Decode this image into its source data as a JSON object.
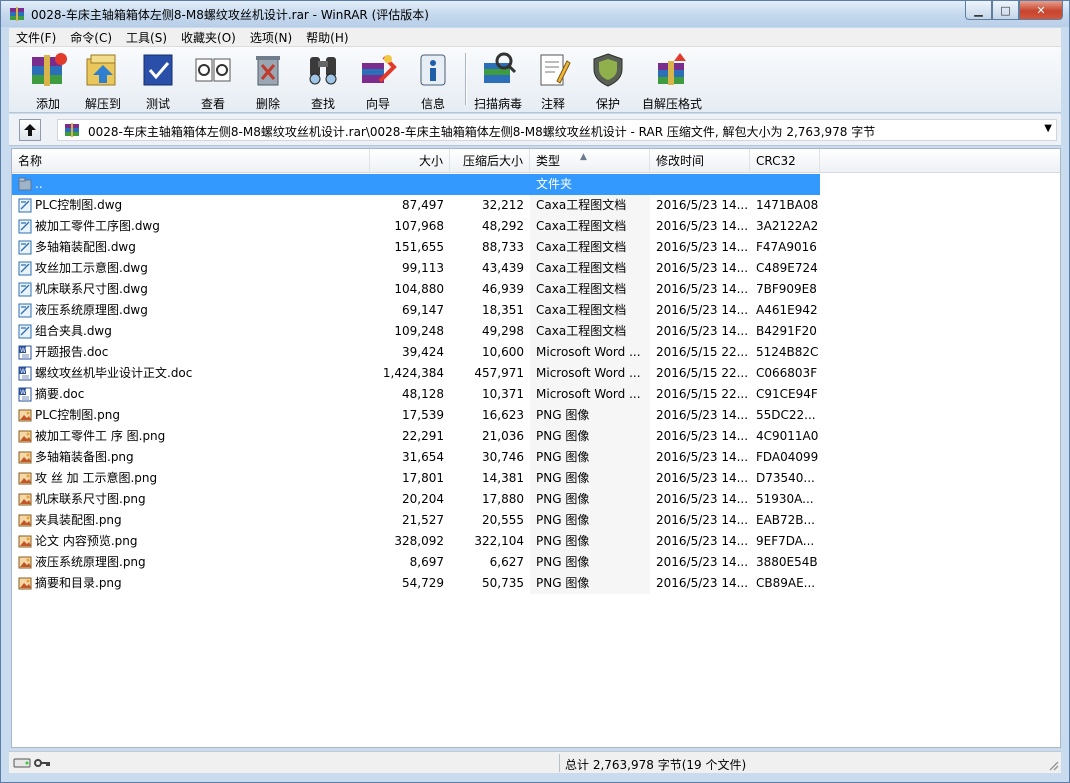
{
  "window": {
    "title": "0028-车床主轴箱箱体左侧8-M8螺纹攻丝机设计.rar - WinRAR (评估版本)",
    "controls": {
      "minimize": "▁",
      "maximize": "□",
      "close": "✕"
    }
  },
  "menu": [
    {
      "label": "文件(F)"
    },
    {
      "label": "命令(C)"
    },
    {
      "label": "工具(S)"
    },
    {
      "label": "收藏夹(O)"
    },
    {
      "label": "选项(N)"
    },
    {
      "label": "帮助(H)"
    }
  ],
  "toolbar": [
    {
      "label": "添加",
      "icon": "add-archive-icon"
    },
    {
      "label": "解压到",
      "icon": "extract-to-icon"
    },
    {
      "label": "测试",
      "icon": "test-icon"
    },
    {
      "label": "查看",
      "icon": "view-icon"
    },
    {
      "label": "删除",
      "icon": "delete-icon"
    },
    {
      "label": "查找",
      "icon": "find-icon"
    },
    {
      "label": "向导",
      "icon": "wizard-icon"
    },
    {
      "label": "信息",
      "icon": "info-icon"
    },
    {
      "label": "扫描病毒",
      "icon": "virus-scan-icon"
    },
    {
      "label": "注释",
      "icon": "comment-icon"
    },
    {
      "label": "保护",
      "icon": "protect-icon"
    },
    {
      "label": "自解压格式",
      "icon": "sfx-icon"
    }
  ],
  "address": {
    "path": "0028-车床主轴箱箱体左侧8-M8螺纹攻丝机设计.rar\\0028-车床主轴箱箱体左侧8-M8螺纹攻丝机设计 - RAR 压缩文件, 解包大小为 2,763,978 字节"
  },
  "columns": {
    "name": "名称",
    "size": "大小",
    "packed": "压缩后大小",
    "type": "类型",
    "mtime": "修改时间",
    "crc": "CRC32"
  },
  "files": [
    {
      "name": "..",
      "size": "",
      "packed": "",
      "type": "文件夹",
      "mtime": "",
      "crc": "",
      "kind": "folder",
      "selected": true
    },
    {
      "name": "PLC控制图.dwg",
      "size": "87,497",
      "packed": "32,212",
      "type": "Caxa工程图文档",
      "mtime": "2016/5/23 14...",
      "crc": "1471BA08",
      "kind": "dwg"
    },
    {
      "name": "被加工零件工序图.dwg",
      "size": "107,968",
      "packed": "48,292",
      "type": "Caxa工程图文档",
      "mtime": "2016/5/23 14...",
      "crc": "3A2122A2",
      "kind": "dwg"
    },
    {
      "name": "多轴箱装配图.dwg",
      "size": "151,655",
      "packed": "88,733",
      "type": "Caxa工程图文档",
      "mtime": "2016/5/23 14...",
      "crc": "F47A9016",
      "kind": "dwg"
    },
    {
      "name": "攻丝加工示意图.dwg",
      "size": "99,113",
      "packed": "43,439",
      "type": "Caxa工程图文档",
      "mtime": "2016/5/23 14...",
      "crc": "C489E724",
      "kind": "dwg"
    },
    {
      "name": "机床联系尺寸图.dwg",
      "size": "104,880",
      "packed": "46,939",
      "type": "Caxa工程图文档",
      "mtime": "2016/5/23 14...",
      "crc": "7BF909E8",
      "kind": "dwg"
    },
    {
      "name": "液压系统原理图.dwg",
      "size": "69,147",
      "packed": "18,351",
      "type": "Caxa工程图文档",
      "mtime": "2016/5/23 14...",
      "crc": "A461E942",
      "kind": "dwg"
    },
    {
      "name": "组合夹具.dwg",
      "size": "109,248",
      "packed": "49,298",
      "type": "Caxa工程图文档",
      "mtime": "2016/5/23 14...",
      "crc": "B4291F20",
      "kind": "dwg"
    },
    {
      "name": "开题报告.doc",
      "size": "39,424",
      "packed": "10,600",
      "type": "Microsoft Word ...",
      "mtime": "2016/5/15 22...",
      "crc": "5124B82C",
      "kind": "doc"
    },
    {
      "name": "螺纹攻丝机毕业设计正文.doc",
      "size": "1,424,384",
      "packed": "457,971",
      "type": "Microsoft Word ...",
      "mtime": "2016/5/15 22...",
      "crc": "C066803F",
      "kind": "doc"
    },
    {
      "name": "摘要.doc",
      "size": "48,128",
      "packed": "10,371",
      "type": "Microsoft Word ...",
      "mtime": "2016/5/15 22...",
      "crc": "C91CE94F",
      "kind": "doc"
    },
    {
      "name": "PLC控制图.png",
      "size": "17,539",
      "packed": "16,623",
      "type": "PNG 图像",
      "mtime": "2016/5/23 14...",
      "crc": "55DC22...",
      "kind": "png"
    },
    {
      "name": "被加工零件工 序 图.png",
      "size": "22,291",
      "packed": "21,036",
      "type": "PNG 图像",
      "mtime": "2016/5/23 14...",
      "crc": "4C9011A0",
      "kind": "png"
    },
    {
      "name": "多轴箱装备图.png",
      "size": "31,654",
      "packed": "30,746",
      "type": "PNG 图像",
      "mtime": "2016/5/23 14...",
      "crc": "FDA04099",
      "kind": "png"
    },
    {
      "name": "攻 丝 加 工示意图.png",
      "size": "17,801",
      "packed": "14,381",
      "type": "PNG 图像",
      "mtime": "2016/5/23 14...",
      "crc": "D73540...",
      "kind": "png"
    },
    {
      "name": "机床联系尺寸图.png",
      "size": "20,204",
      "packed": "17,880",
      "type": "PNG 图像",
      "mtime": "2016/5/23 14...",
      "crc": "51930A...",
      "kind": "png"
    },
    {
      "name": "夹具装配图.png",
      "size": "21,527",
      "packed": "20,555",
      "type": "PNG 图像",
      "mtime": "2016/5/23 14...",
      "crc": "EAB72B...",
      "kind": "png"
    },
    {
      "name": "论文 内容预览.png",
      "size": "328,092",
      "packed": "322,104",
      "type": "PNG 图像",
      "mtime": "2016/5/23 14...",
      "crc": "9EF7DA...",
      "kind": "png"
    },
    {
      "name": "液压系统原理图.png",
      "size": "8,697",
      "packed": "6,627",
      "type": "PNG 图像",
      "mtime": "2016/5/23 14...",
      "crc": "3880E54B",
      "kind": "png"
    },
    {
      "name": "摘要和目录.png",
      "size": "54,729",
      "packed": "50,735",
      "type": "PNG 图像",
      "mtime": "2016/5/23 14...",
      "crc": "CB89AE...",
      "kind": "png"
    }
  ],
  "status": {
    "total": "总计 2,763,978 字节(19 个文件)"
  },
  "colors": {
    "selection": "#3399ff",
    "title_gradient_top": "#e4eef9",
    "close_button": "#c7452f"
  }
}
